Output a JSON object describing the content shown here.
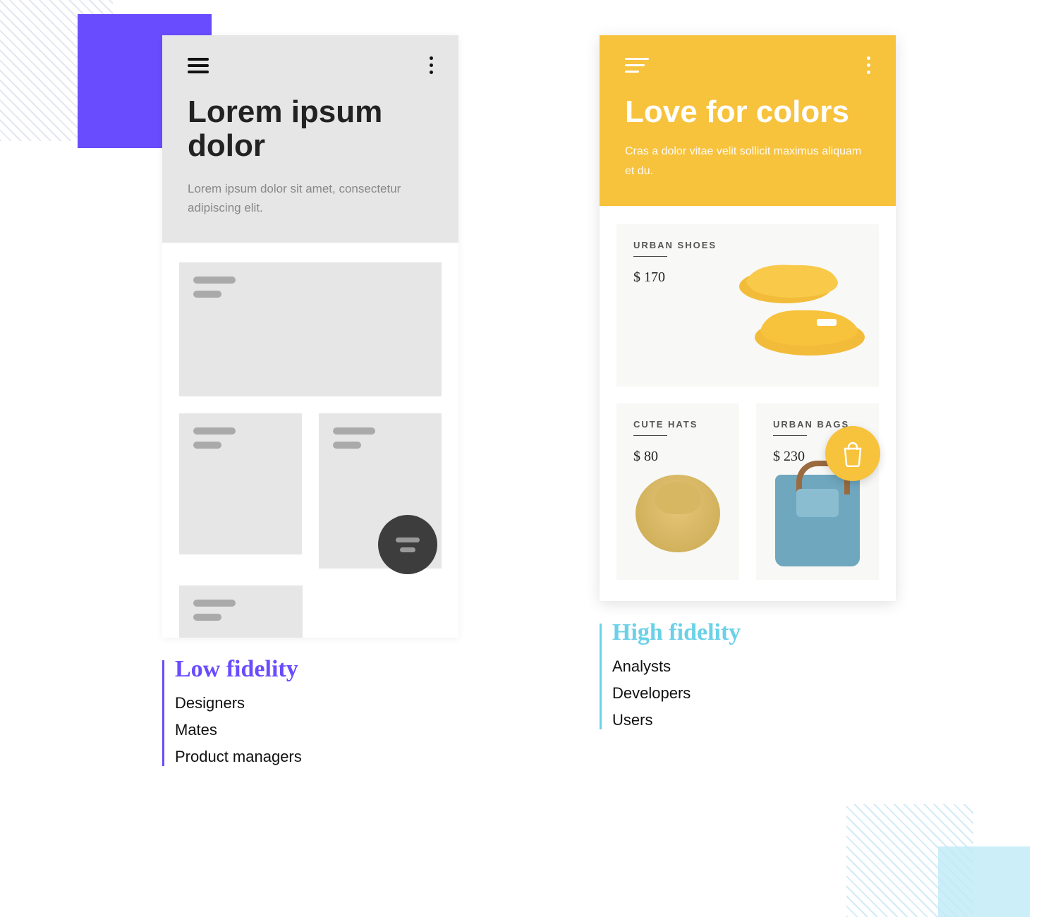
{
  "low_fidelity": {
    "title": "Lorem ipsum dolor",
    "subtitle": "Lorem ipsum dolor sit amet, consectetur adipiscing elit.",
    "caption_title": "Low fidelity",
    "audience": [
      "Designers",
      "Mates",
      "Product managers"
    ]
  },
  "high_fidelity": {
    "title": "Love for colors",
    "subtitle": "Cras a dolor vitae velit sollicit maximus aliquam et du.",
    "caption_title": "High fidelity",
    "audience": [
      "Analysts",
      "Developers",
      "Users"
    ],
    "products": [
      {
        "label": "URBAN SHOES",
        "price": "$ 170"
      },
      {
        "label": "CUTE HATS",
        "price": "$ 80"
      },
      {
        "label": "URBAN BAGS",
        "price": "$ 230"
      }
    ]
  },
  "colors": {
    "accent_purple": "#6a4cff",
    "accent_cyan": "#6ad1e8",
    "accent_yellow": "#f7c23c"
  },
  "icons": {
    "hamburger": "hamburger-icon",
    "more_vertical": "more-vertical-icon",
    "menu_staggered": "menu-staggered-icon",
    "filter": "filter-icon",
    "shopping_bag": "shopping-bag-icon"
  }
}
